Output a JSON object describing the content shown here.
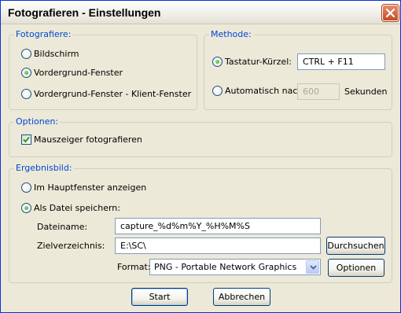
{
  "window": {
    "title": "Fotografieren - Einstellungen"
  },
  "fotografiere": {
    "legend": "Fotografiere:",
    "options": [
      {
        "label": "Bildschirm",
        "selected": false
      },
      {
        "label": "Vordergrund-Fenster",
        "selected": true
      },
      {
        "label": "Vordergrund-Fenster - Klient-Fenster",
        "selected": false
      }
    ]
  },
  "methode": {
    "legend": "Methode:",
    "hotkey_label": "Tastatur-Kürzel:",
    "hotkey_value": "CTRL + F11",
    "hotkey_selected": true,
    "auto_label": "Automatisch nach:",
    "auto_value": "600",
    "auto_selected": false,
    "seconds_label": "Sekunden"
  },
  "optionen": {
    "legend": "Optionen:",
    "mouse_label": "Mauszeiger fotografieren",
    "mouse_checked": true
  },
  "ergebnis": {
    "legend": "Ergebnisbild:",
    "show_main_label": "Im Hauptfenster anzeigen",
    "show_main_selected": false,
    "save_file_label": "Als Datei speichern:",
    "save_file_selected": true,
    "filename_label": "Dateiname:",
    "filename_value": "capture_%d%m%Y_%H%M%S",
    "dir_label": "Zielverzeichnis:",
    "dir_value": "E:\\SC\\",
    "browse_label": "Durchsuchen",
    "format_label": "Format:",
    "format_value": "PNG - Portable Network Graphics",
    "options_label": "Optionen"
  },
  "footer": {
    "start_label": "Start",
    "cancel_label": "Abbrechen"
  },
  "colors": {
    "legend": "#0046D5",
    "dialog_bg": "#ECE9D8",
    "radio_dot": "#21A121",
    "close_button": "#C34A22"
  },
  "icons": {
    "close": "close-icon",
    "checkmark": "checkmark-icon",
    "dropdown": "chevron-down-icon"
  }
}
